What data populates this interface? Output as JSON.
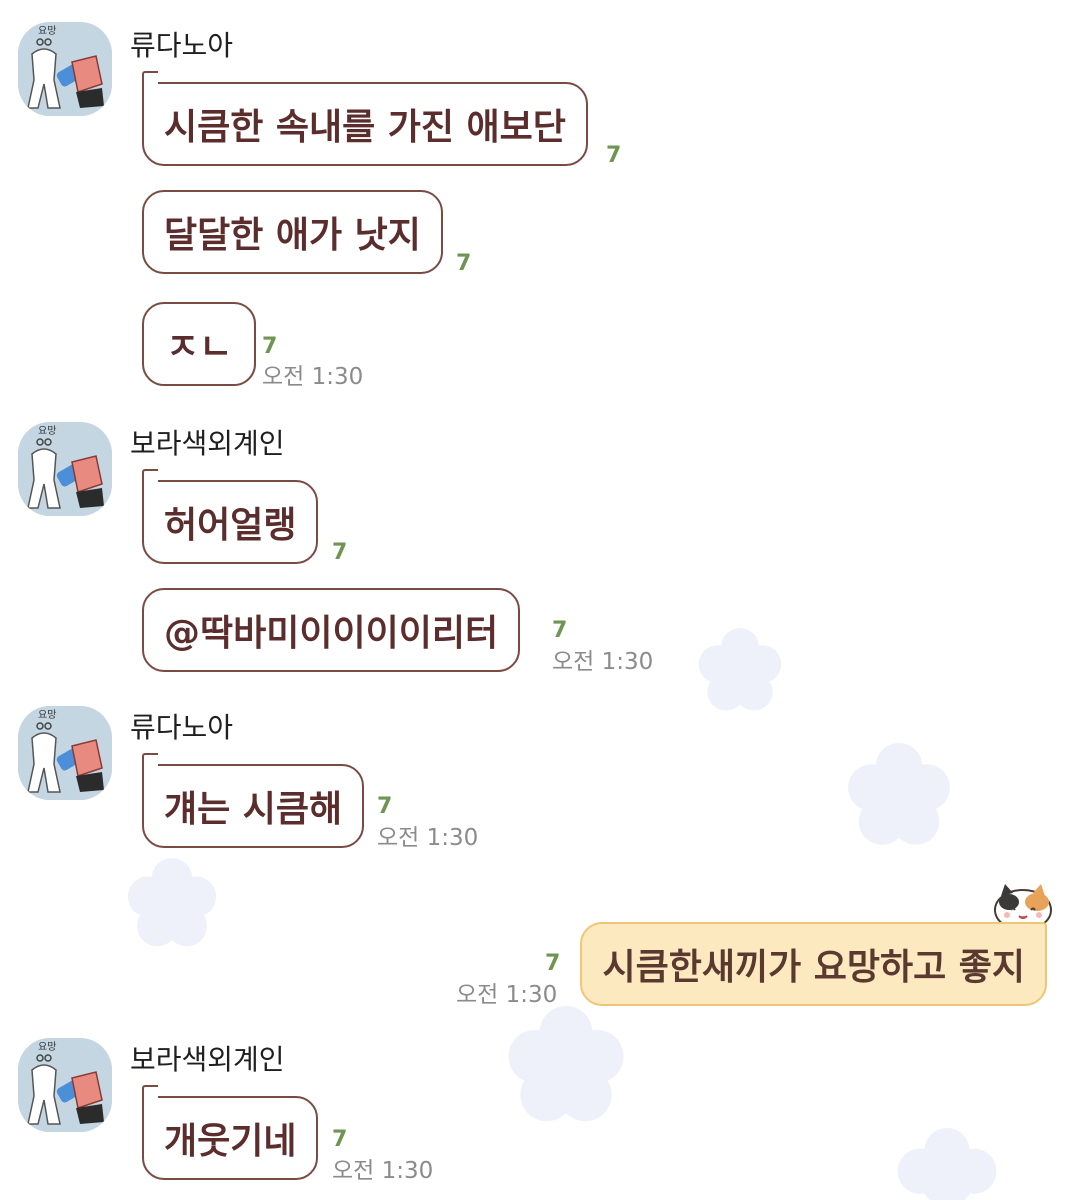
{
  "chat": {
    "messages": [
      {
        "sender": "류다노아",
        "text": "시큼한 속내를 가진 애보단",
        "unread": "7"
      },
      {
        "text": "달달한 애가 낫지",
        "unread": "7"
      },
      {
        "text": "ㅈㄴ",
        "unread": "7",
        "time": "오전 1:30"
      },
      {
        "sender": "보라색외계인",
        "text": "허어얼랭",
        "unread": "7"
      },
      {
        "text": "@딱바미이이이이리터",
        "unread": "7",
        "time": "오전 1:30"
      },
      {
        "sender": "류다노아",
        "text": "걔는 시큼해",
        "unread": "7",
        "time": "오전 1:30"
      },
      {
        "mine": true,
        "text": "시큼한새끼가 요망하고 좋지",
        "unread": "7",
        "time": "오전 1:30"
      },
      {
        "sender": "보라색외계인",
        "text": "개웃기네",
        "unread": "7",
        "time": "오전 1:30"
      }
    ],
    "avatar_label": "요망"
  },
  "colors": {
    "bubble_border": "#7a4a44",
    "bubble_text": "#5c2d2d",
    "my_bubble_bg": "#fde9c0",
    "my_bubble_border": "#efc774",
    "unread_count": "#6f9554",
    "time_text": "#8b8b8b",
    "avatar_bg": "#c4d6e2",
    "background_cloud": "#eef1fa"
  },
  "icons": [
    "profile-avatar",
    "cat-sticker",
    "background-cloud"
  ]
}
